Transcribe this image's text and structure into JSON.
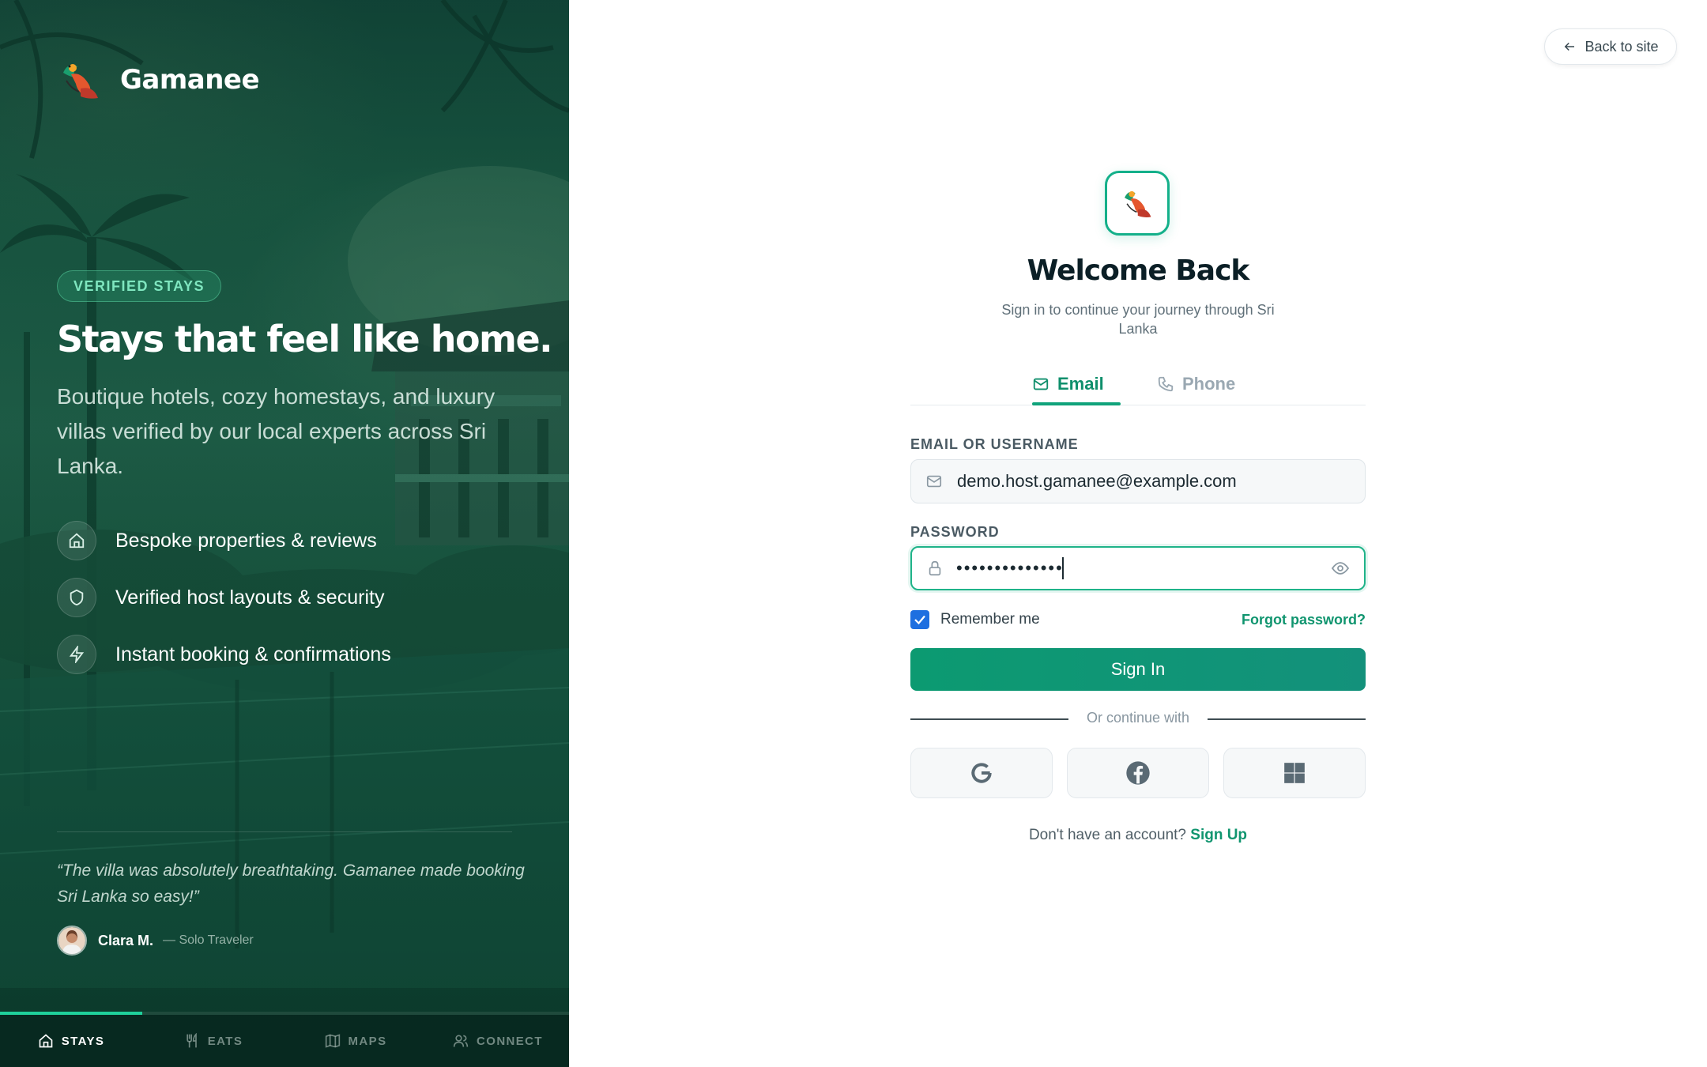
{
  "brand": {
    "name": "Gamanee"
  },
  "hero": {
    "badge": "VERIFIED STAYS",
    "title": "Stays that feel like home.",
    "description": "Boutique hotels, cozy homestays, and luxury villas verified by our local experts across Sri Lanka.",
    "features": [
      {
        "icon": "home-icon",
        "label": "Bespoke properties & reviews"
      },
      {
        "icon": "shield-icon",
        "label": "Verified host layouts & security"
      },
      {
        "icon": "lightning-icon",
        "label": "Instant booking & confirmations"
      }
    ],
    "testimonial": {
      "quote": "“The villa was absolutely breathtaking. Gamanee made booking Sri Lanka so easy!”",
      "author": "Clara M.",
      "role": "— Solo Traveler"
    }
  },
  "bottom_nav": {
    "items": [
      {
        "icon": "home-icon",
        "label": "STAYS",
        "active": true
      },
      {
        "icon": "fork-knife-icon",
        "label": "EATS",
        "active": false
      },
      {
        "icon": "map-icon",
        "label": "MAPS",
        "active": false
      },
      {
        "icon": "users-icon",
        "label": "CONNECT",
        "active": false
      }
    ]
  },
  "header": {
    "back_label": "Back to site"
  },
  "form": {
    "title": "Welcome Back",
    "subtitle": "Sign in to continue your journey through Sri Lanka",
    "tabs": [
      {
        "icon": "mail-icon",
        "label": "Email",
        "active": true
      },
      {
        "icon": "phone-icon",
        "label": "Phone",
        "active": false
      }
    ],
    "email_label": "EMAIL OR USERNAME",
    "email_value": "demo.host.gamanee@example.com",
    "password_label": "PASSWORD",
    "password_value": "••••••••••••••",
    "remember_label": "Remember me",
    "remember_checked": true,
    "forgot_label": "Forgot password?",
    "submit_label": "Sign In",
    "divider_text": "Or continue with",
    "social": [
      "google-icon",
      "facebook-icon",
      "microsoft-icon"
    ],
    "signup_prompt": "Don't have an account?",
    "signup_link": "Sign Up"
  },
  "colors": {
    "accent": "#10956f",
    "hero_bg": "#1d5a43",
    "checkbox": "#1e6fe0"
  }
}
